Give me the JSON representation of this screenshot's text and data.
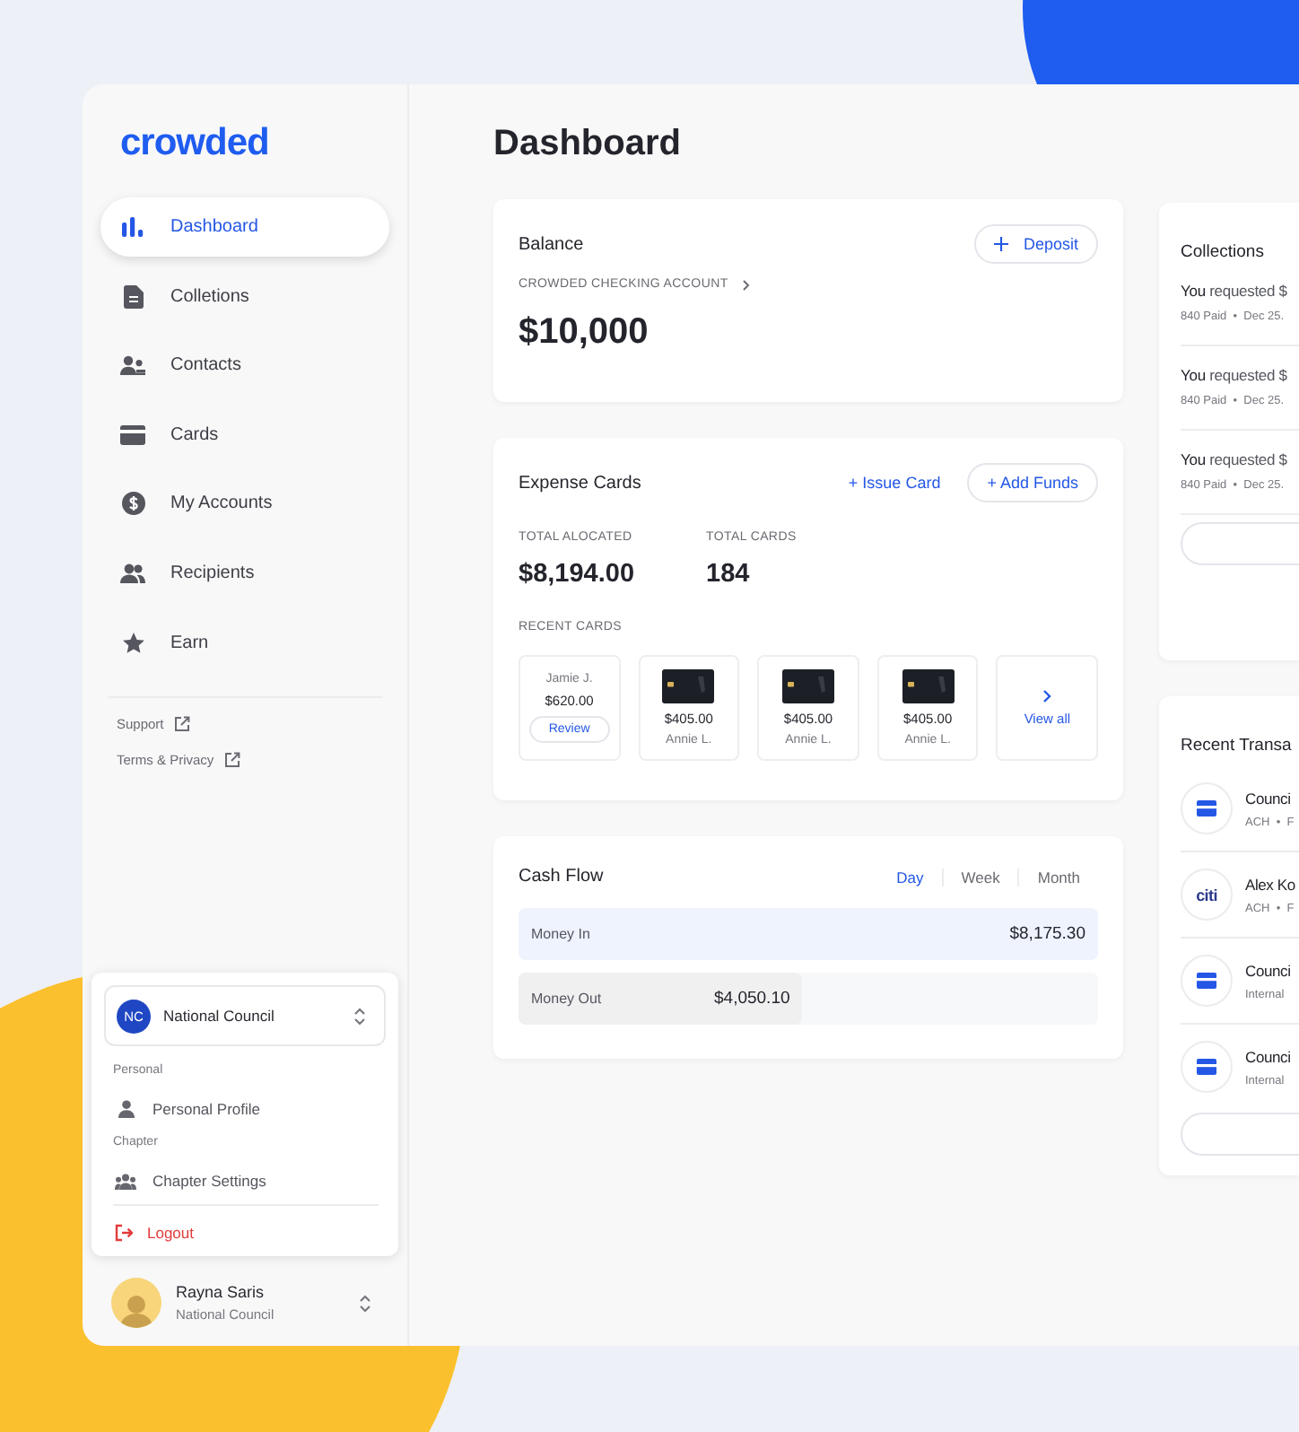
{
  "sidebar": {
    "logo": "crowded",
    "nav": [
      {
        "label": "Dashboard",
        "selected": true
      },
      {
        "label": "Colletions",
        "selected": false
      },
      {
        "label": "Contacts",
        "selected": false
      },
      {
        "label": "Cards",
        "selected": false
      },
      {
        "label": "My Accounts",
        "selected": false
      },
      {
        "label": "Recipients",
        "selected": false
      },
      {
        "label": "Earn",
        "selected": false
      }
    ],
    "links": [
      "Support",
      "Terms & Privacy"
    ],
    "account_menu": {
      "org": {
        "initials": "NC",
        "name": "National Council"
      },
      "sections": [
        {
          "title": "Personal",
          "items": [
            {
              "label": "Personal Profile"
            }
          ]
        },
        {
          "title": "Chapter",
          "items": [
            {
              "label": "Chapter Settings"
            }
          ]
        }
      ],
      "logout": "Logout"
    },
    "user": {
      "name": "Rayna Saris",
      "org": "National Council"
    }
  },
  "page_title": "Dashboard",
  "balance": {
    "title": "Balance",
    "button": "Deposit",
    "account": "CROWDED CHECKING ACCOUNT",
    "amount": "$10,000"
  },
  "expense_cards": {
    "title": "Expense Cards",
    "link": "+ Issue Card",
    "button": "+ Add Funds",
    "stats": [
      {
        "label": "TOTAL ALOCATED",
        "value": "$8,194.00"
      },
      {
        "label": "TOTAL CARDS",
        "value": "184"
      }
    ],
    "recent_label": "RECENT CARDS",
    "recent": [
      {
        "kind": "pending",
        "name": "Jamie J.",
        "amount": "$620.00",
        "action": "Review"
      },
      {
        "kind": "card",
        "amount": "$405.00",
        "name": "Annie L."
      },
      {
        "kind": "card",
        "amount": "$405.00",
        "name": "Annie L."
      },
      {
        "kind": "card",
        "amount": "$405.00",
        "name": "Annie L."
      },
      {
        "kind": "view_all",
        "label": "View all"
      }
    ]
  },
  "cash_flow": {
    "title": "Cash Flow",
    "tabs": [
      {
        "label": "Day",
        "selected": true
      },
      {
        "label": "Week",
        "selected": false
      },
      {
        "label": "Month",
        "selected": false
      }
    ],
    "bars": [
      {
        "label": "Money In",
        "amount": "$8,175.30",
        "level": 1,
        "color": "#eef3fd"
      },
      {
        "label": "Money Out",
        "amount": "$4,050.10",
        "level": 0.49,
        "color": "#f0f0f1"
      }
    ]
  },
  "collections": {
    "title": "Collections",
    "items": [
      {
        "text": "**You** requested $",
        "meta": "840 Paid  •  Dec 25."
      },
      {
        "text": "**You** requested $",
        "meta": "840 Paid  •  Dec 25."
      },
      {
        "text": "**You** requested $",
        "meta": "840 Paid  •  Dec 25."
      }
    ]
  },
  "recent_transactions": {
    "title": "Recent Transa",
    "items": [
      {
        "kind": "card",
        "name": "Counci",
        "meta": "ACH  •  F"
      },
      {
        "kind": "bank",
        "logo": "citi",
        "name": "Alex Ko",
        "meta": "ACH  •  F"
      },
      {
        "kind": "card",
        "name": "Counci",
        "meta": "Internal"
      },
      {
        "kind": "card",
        "name": "Counci",
        "meta": "Internal"
      }
    ]
  }
}
